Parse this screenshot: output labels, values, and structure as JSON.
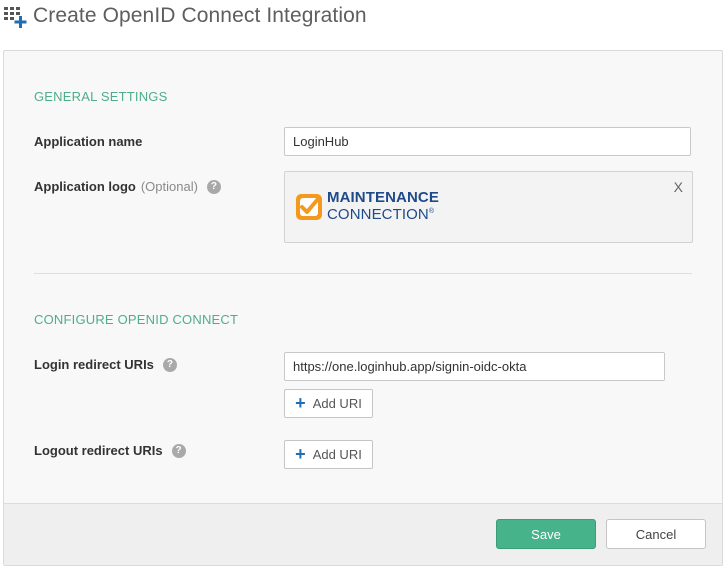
{
  "header": {
    "title": "Create OpenID Connect Integration",
    "icon": "grid-plus-icon"
  },
  "general_settings": {
    "heading": "GENERAL SETTINGS",
    "app_name_label": "Application name",
    "app_name_value": "LoginHub",
    "app_logo_label": "Application logo",
    "app_logo_optional": "(Optional)",
    "help_glyph": "?",
    "logo_remove": "X",
    "logo_line1": "MAINTENANCE",
    "logo_line2": "CONNECTION",
    "logo_reg": "®"
  },
  "openid_connect": {
    "heading": "CONFIGURE OPENID CONNECT",
    "login_redirect_label": "Login redirect URIs",
    "login_redirect_value": "https://one.loginhub.app/signin-oidc-okta",
    "logout_redirect_label": "Logout redirect URIs",
    "add_uri_label": "Add URI"
  },
  "footer": {
    "save_label": "Save",
    "cancel_label": "Cancel"
  },
  "colors": {
    "accent_green": "#46b38a",
    "heading_green": "#4fae8a",
    "plus_blue": "#1c6fb5",
    "logo_blue": "#1f4a8a",
    "logo_orange": "#f39a1e"
  }
}
